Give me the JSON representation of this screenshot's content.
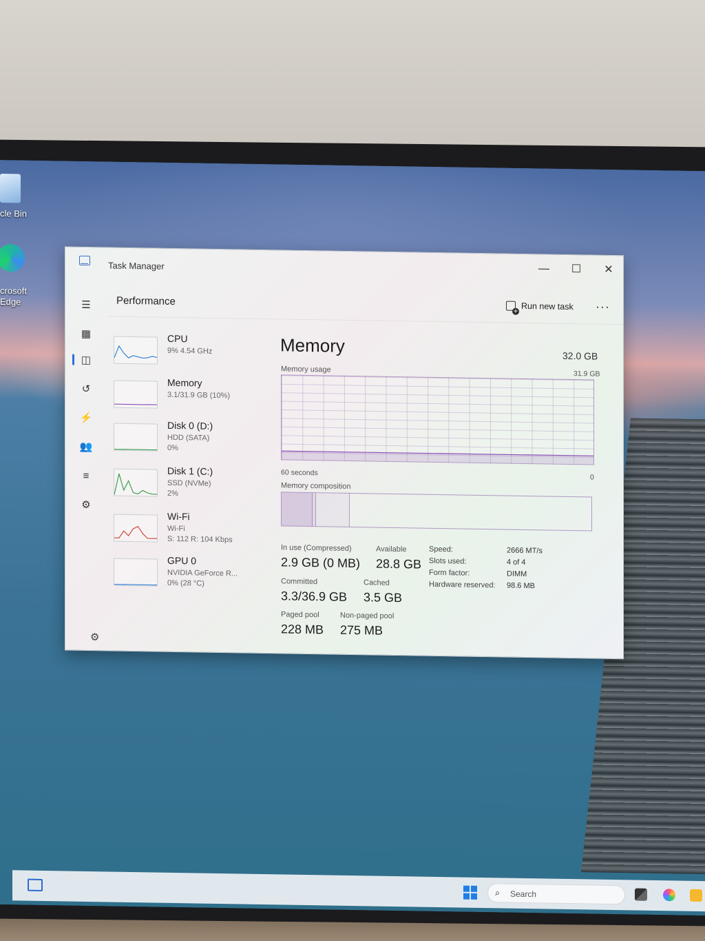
{
  "desktop": {
    "recycle_bin_label": "cle Bin",
    "edge_label_1": "crosoft",
    "edge_label_2": "Edge"
  },
  "window": {
    "title": "Task Manager",
    "minimize": "—",
    "maximize": "☐",
    "close": "✕"
  },
  "header": {
    "page_title": "Performance",
    "run_new_task": "Run new task",
    "more": "···"
  },
  "nav": {
    "icons": [
      "menu-icon",
      "processes-icon",
      "performance-icon",
      "app-history-icon",
      "startup-apps-icon",
      "users-icon",
      "details-icon",
      "services-icon",
      "settings-icon"
    ]
  },
  "devices": [
    {
      "name": "CPU",
      "line1": "9%  4.54 GHz",
      "line2": "",
      "color": "#2b7fd6",
      "values": [
        0.2,
        0.7,
        0.4,
        0.2,
        0.3,
        0.25,
        0.2,
        0.22,
        0.28,
        0.24
      ]
    },
    {
      "name": "Memory",
      "line1": "3.1/31.9 GB (10%)",
      "line2": "",
      "color": "#8a4fb5",
      "values": [
        0.1,
        0.1,
        0.1,
        0.1,
        0.1,
        0.1,
        0.1,
        0.1,
        0.1,
        0.1
      ]
    },
    {
      "name": "Disk 0 (D:)",
      "line1": "HDD (SATA)",
      "line2": "0%",
      "color": "#3a9a4a",
      "values": [
        0,
        0,
        0,
        0,
        0,
        0,
        0,
        0,
        0,
        0
      ]
    },
    {
      "name": "Disk 1 (C:)",
      "line1": "SSD (NVMe)",
      "line2": "2%",
      "color": "#3a9a4a",
      "values": [
        0,
        0.9,
        0.2,
        0.6,
        0.1,
        0.05,
        0.2,
        0.1,
        0.05,
        0.05
      ]
    },
    {
      "name": "Wi-Fi",
      "line1": "Wi-Fi",
      "line2": "S: 112  R: 104 Kbps",
      "color": "#c8442e",
      "values": [
        0.1,
        0.1,
        0.4,
        0.2,
        0.5,
        0.6,
        0.3,
        0.1,
        0.1,
        0.1
      ]
    },
    {
      "name": "GPU 0",
      "line1": "NVIDIA GeForce R...",
      "line2": "0%  (28 °C)",
      "color": "#2b7fd6",
      "values": [
        0,
        0,
        0,
        0,
        0,
        0,
        0,
        0,
        0,
        0
      ]
    }
  ],
  "memory": {
    "title": "Memory",
    "total": "32.0 GB",
    "usage_label": "Memory usage",
    "usage_max": "31.9 GB",
    "graph_left": "60 seconds",
    "graph_right": "0",
    "usage_fraction": 0.1,
    "composition_label": "Memory composition",
    "composition": {
      "in_use": 0.1,
      "modified": 0.01,
      "standby": 0.11
    },
    "stats": {
      "in_use_label": "In use (Compressed)",
      "in_use_value": "2.9 GB (0 MB)",
      "available_label": "Available",
      "available_value": "28.8 GB",
      "committed_label": "Committed",
      "committed_value": "3.3/36.9 GB",
      "cached_label": "Cached",
      "cached_value": "3.5 GB",
      "paged_label": "Paged pool",
      "paged_value": "228 MB",
      "nonpaged_label": "Non-paged pool",
      "nonpaged_value": "275 MB"
    },
    "specs": {
      "speed_label": "Speed:",
      "speed_value": "2666 MT/s",
      "slots_label": "Slots used:",
      "slots_value": "4 of 4",
      "form_label": "Form factor:",
      "form_value": "DIMM",
      "reserved_label": "Hardware reserved:",
      "reserved_value": "98.6 MB"
    },
    "accent": "#8a4fb5"
  },
  "taskbar": {
    "search_placeholder": "Search"
  }
}
